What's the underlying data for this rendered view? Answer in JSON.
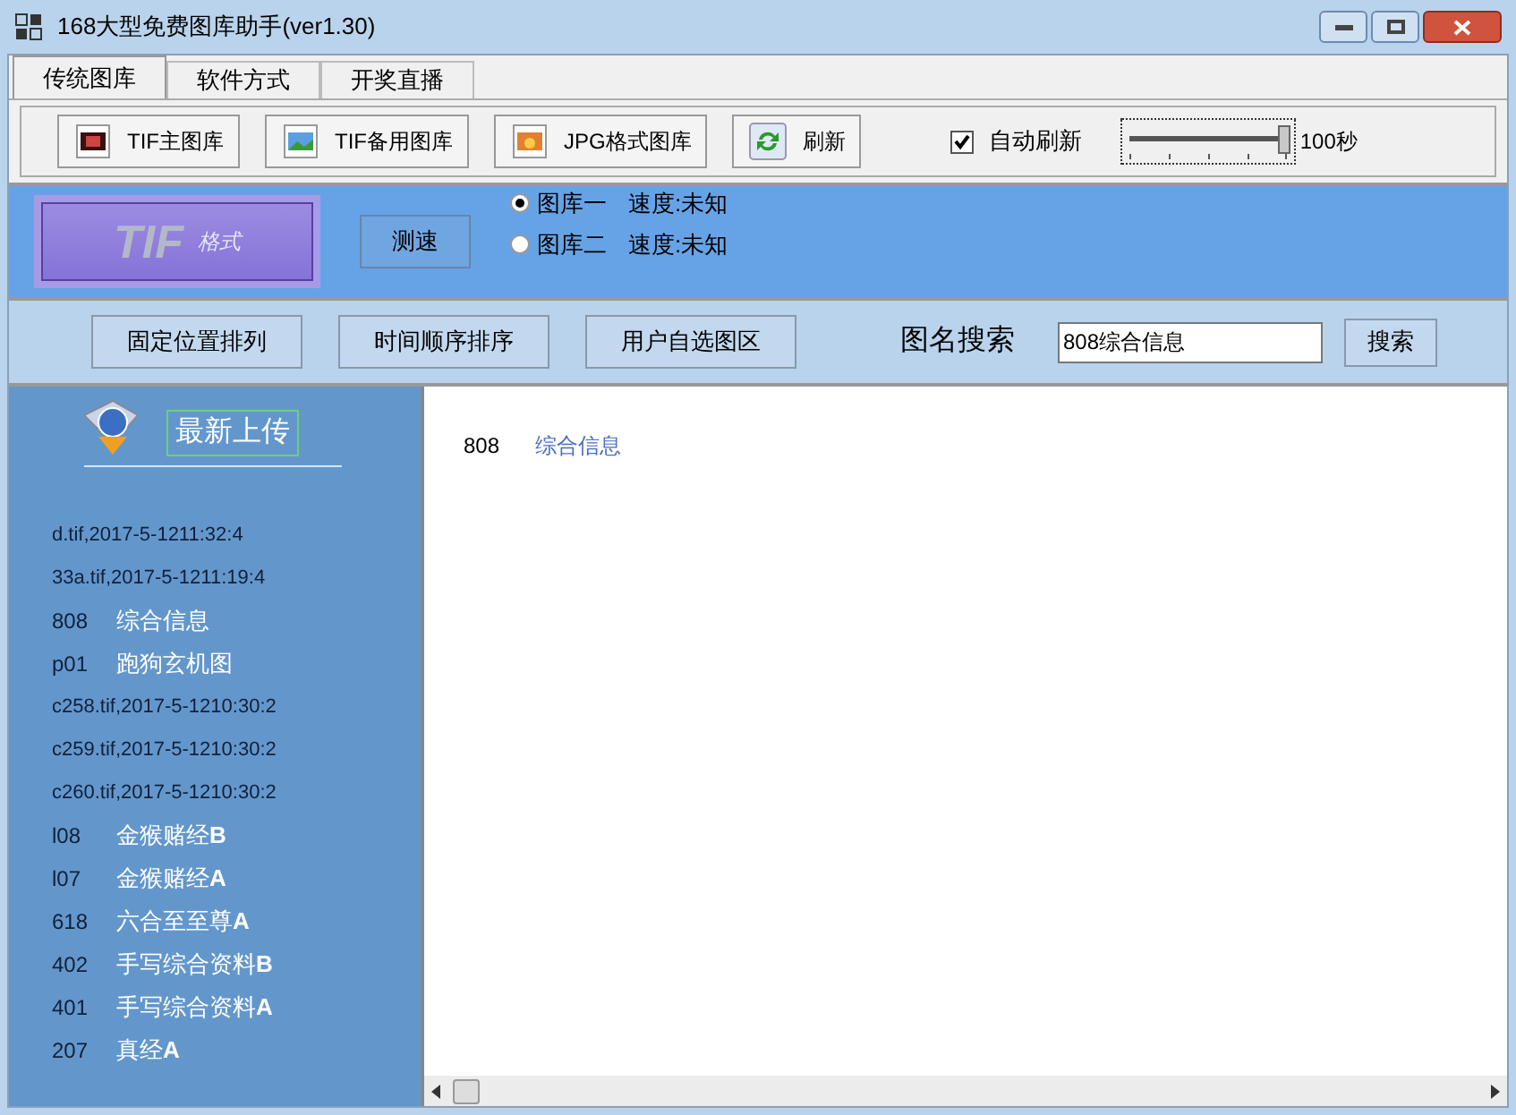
{
  "window": {
    "title": "168大型免费图库助手(ver1.30)"
  },
  "tabs": [
    {
      "label": "传统图库",
      "selected": true
    },
    {
      "label": "软件方式",
      "selected": false
    },
    {
      "label": "开奖直播",
      "selected": false
    }
  ],
  "toolbar": {
    "buttons": [
      {
        "label": "TIF主图库",
        "kind": "tif-main"
      },
      {
        "label": "TIF备用图库",
        "kind": "tif-backup"
      },
      {
        "label": "JPG格式图库",
        "kind": "jpg"
      },
      {
        "label": "刷新",
        "kind": "refresh"
      }
    ],
    "auto_refresh": {
      "label": "自动刷新",
      "checked": true
    },
    "interval_slider": {
      "level": 1.0
    },
    "interval_reading": "100秒"
  },
  "speed_panel": {
    "logo_text": "TIF",
    "logo_subtext": "格式",
    "test_button": "测速",
    "sources": [
      {
        "label": "图库一",
        "speed": "速度:未知",
        "selected": true
      },
      {
        "label": "图库二",
        "speed": "速度:未知",
        "selected": false
      }
    ]
  },
  "sort_bar": {
    "buttons": [
      "固定位置排列",
      "时间顺序排序",
      "用户自选图区"
    ],
    "search_label": "图名搜索",
    "search_value": "808综合信息",
    "search_button": "搜索"
  },
  "sidebar": {
    "title": "最新上传",
    "items": [
      {
        "kind": "file",
        "text": "d.tif,2017-5-1211:32:4"
      },
      {
        "kind": "file",
        "text": "33a.tif,2017-5-1211:19:4"
      },
      {
        "kind": "entry",
        "code": "808",
        "name": "综合信息"
      },
      {
        "kind": "entry",
        "code": "p01",
        "name": "跑狗玄机图"
      },
      {
        "kind": "file",
        "text": "c258.tif,2017-5-1210:30:2"
      },
      {
        "kind": "file",
        "text": "c259.tif,2017-5-1210:30:2"
      },
      {
        "kind": "file",
        "text": "c260.tif,2017-5-1210:30:2"
      },
      {
        "kind": "entry",
        "code": "l08",
        "name": "金猴赌经**B**"
      },
      {
        "kind": "entry",
        "code": "l07",
        "name": "金猴赌经**A**"
      },
      {
        "kind": "entry",
        "code": "618",
        "name": "六合至至尊**A**"
      },
      {
        "kind": "entry",
        "code": "402",
        "name": "手写综合资料**B**"
      },
      {
        "kind": "entry",
        "code": "401",
        "name": "手写综合资料**A**"
      },
      {
        "kind": "entry",
        "code": "207",
        "name": "真经**A**"
      }
    ]
  },
  "content": {
    "items": [
      {
        "code": "808",
        "name": "综合信息"
      }
    ]
  }
}
